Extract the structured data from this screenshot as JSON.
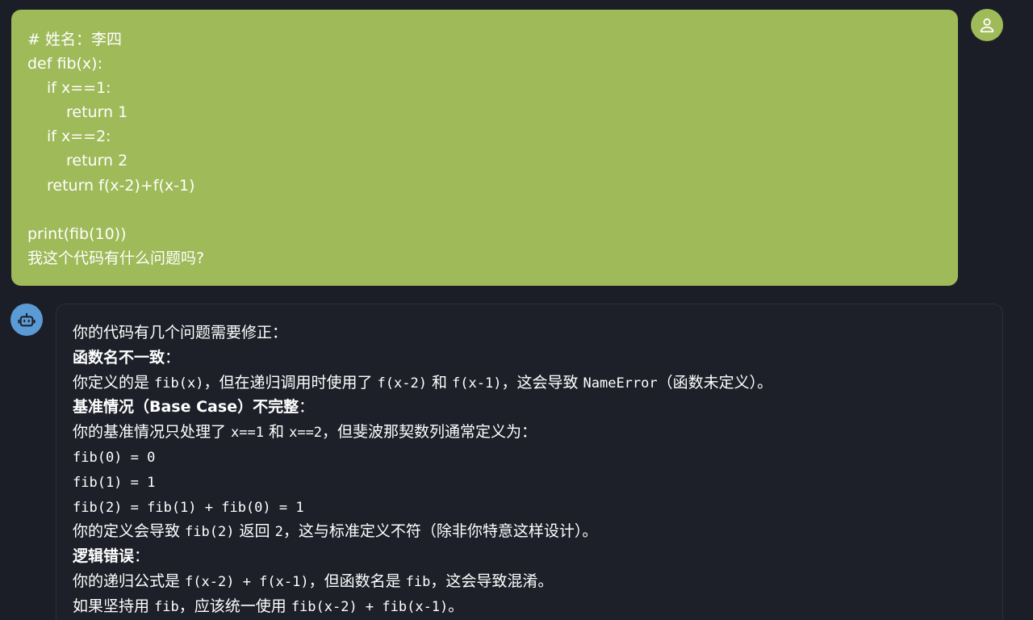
{
  "user_message": {
    "lines": [
      "# 姓名：李四",
      "def fib(x):",
      "if x==1:",
      "return 1",
      "if x==2:",
      "return 2",
      "return f(x-2)+f(x-1)",
      "",
      "print(fib(10))",
      "我这个代码有什么问题吗?"
    ]
  },
  "bot_message": {
    "intro": "你的代码有几个问题需要修正：",
    "s1_title": "函数名不一致",
    "s1_colon": "：",
    "s1_a": "你定义的是 ",
    "s1_c1": "fib(x)",
    "s1_b": "，但在递归调用时使用了 ",
    "s1_c2": "f(x-2)",
    "s1_and": " 和 ",
    "s1_c3": "f(x-1)",
    "s1_d": "，这会导致 ",
    "s1_c4": "NameError",
    "s1_e": "（函数未定义）。",
    "s2_title": "基准情况（Base Case）不完整",
    "s2_colon": "：",
    "s2_a": "你的基准情况只处理了 ",
    "s2_c1": "x==1",
    "s2_and": " 和 ",
    "s2_c2": "x==2",
    "s2_b": "，但斐波那契数列通常定义为：",
    "fib0": "fib(0) = 0",
    "fib1": "fib(1) = 1",
    "fib2": "fib(2) = fib(1) + fib(0) = 1",
    "s2_d": "你的定义会导致 ",
    "s2_c3": "fib(2)",
    "s2_e": " 返回 ",
    "s2_c4": "2",
    "s2_f": "，这与标准定义不符（除非你特意这样设计）。",
    "s3_title": "逻辑错误",
    "s3_colon": "：",
    "s3_a": "你的递归公式是 ",
    "s3_c1": "f(x-2) + f(x-1)",
    "s3_b": "，但函数名是 ",
    "s3_c2": "fib",
    "s3_c": "，这会导致混淆。",
    "s3_d": "如果坚持用 ",
    "s3_c3": "fib",
    "s3_e": "，应该统一使用 ",
    "s3_c4": "fib(x-2) + fib(x-1)",
    "s3_f": "。"
  },
  "icons": {
    "user_avatar": "user-icon",
    "bot_avatar": "robot-icon"
  },
  "colors": {
    "background": "#1b1e27",
    "user_bubble": "#9fba59",
    "bot_avatar": "#5b9bd5"
  }
}
